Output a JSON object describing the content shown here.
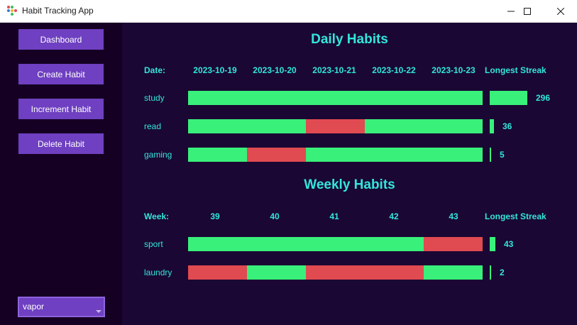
{
  "window": {
    "title": "Habit Tracking App"
  },
  "sidebar": {
    "buttons": [
      {
        "label": "Dashboard"
      },
      {
        "label": "Create Habit"
      },
      {
        "label": "Increment Habit"
      },
      {
        "label": "Delete Habit"
      }
    ],
    "theme_select": {
      "value": "vapor"
    }
  },
  "daily": {
    "title": "Daily Habits",
    "header_label": "Date:",
    "columns": [
      "2023-10-19",
      "2023-10-20",
      "2023-10-21",
      "2023-10-22",
      "2023-10-23"
    ],
    "streak_header": "Longest Streak",
    "max_streak": 296,
    "rows": [
      {
        "name": "study",
        "status": [
          "done",
          "done",
          "done",
          "done",
          "done"
        ],
        "streak": 296
      },
      {
        "name": "read",
        "status": [
          "done",
          "done",
          "missed",
          "done",
          "done"
        ],
        "streak": 36
      },
      {
        "name": "gaming",
        "status": [
          "done",
          "missed",
          "done",
          "done",
          "done"
        ],
        "streak": 5
      }
    ]
  },
  "weekly": {
    "title": "Weekly Habits",
    "header_label": "Week:",
    "columns": [
      "39",
      "40",
      "41",
      "42",
      "43"
    ],
    "streak_header": "Longest Streak",
    "max_streak": 296,
    "rows": [
      {
        "name": "sport",
        "status": [
          "done",
          "done",
          "done",
          "done",
          "missed"
        ],
        "streak": 43
      },
      {
        "name": "laundry",
        "status": [
          "missed",
          "done",
          "missed",
          "missed",
          "done"
        ],
        "streak": 2
      }
    ]
  },
  "colors": {
    "done": "#39f07a",
    "missed": "#e04a51",
    "accent": "#32e6dc",
    "button": "#6f40c1"
  }
}
